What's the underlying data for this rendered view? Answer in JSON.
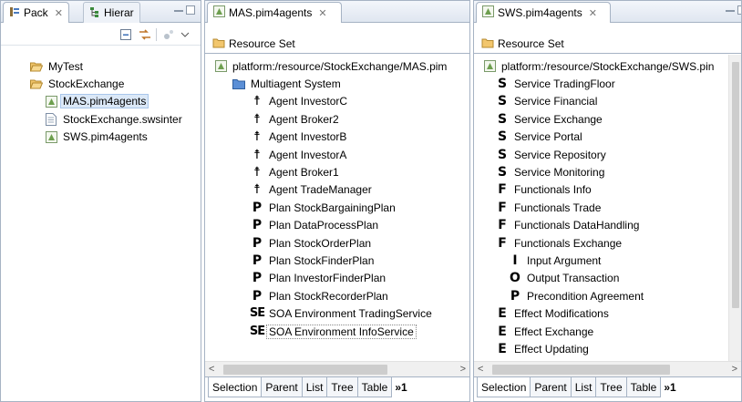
{
  "pack_pane": {
    "tabs": [
      {
        "label": "Pack",
        "active": true,
        "icon": "package-explorer-icon"
      },
      {
        "label": "Hierar",
        "active": false,
        "icon": "hierarchy-icon"
      }
    ],
    "tree": [
      {
        "label": "MyTest",
        "icon": "folder-open-icon",
        "depth": 1
      },
      {
        "label": "StockExchange",
        "icon": "folder-open-icon",
        "depth": 1
      },
      {
        "label": "MAS.pim4agents",
        "icon": "model-file-icon",
        "depth": 2,
        "selected": true
      },
      {
        "label": "StockExchange.swsinter",
        "icon": "text-file-icon",
        "depth": 2
      },
      {
        "label": "SWS.pim4agents",
        "icon": "model-file-icon",
        "depth": 2
      }
    ]
  },
  "mas_pane": {
    "tab_label": "MAS.pim4agents",
    "resource_set": "Resource Set",
    "tree": [
      {
        "label": "platform:/resource/StockExchange/MAS.pim",
        "icon": "model-file-icon",
        "glyph": "",
        "depth": 0
      },
      {
        "label": "Multiagent System",
        "icon": "folder-icon",
        "glyph": "",
        "depth": 1
      },
      {
        "label": "Agent InvestorC",
        "icon": "agent-icon",
        "glyph": "☨",
        "depth": 2
      },
      {
        "label": "Agent Broker2",
        "icon": "agent-icon",
        "glyph": "☨",
        "depth": 2
      },
      {
        "label": "Agent InvestorB",
        "icon": "agent-icon",
        "glyph": "☨",
        "depth": 2
      },
      {
        "label": "Agent InvestorA",
        "icon": "agent-icon",
        "glyph": "☨",
        "depth": 2
      },
      {
        "label": "Agent Broker1",
        "icon": "agent-icon",
        "glyph": "☨",
        "depth": 2
      },
      {
        "label": "Agent TradeManager",
        "icon": "agent-icon",
        "glyph": "☨",
        "depth": 2
      },
      {
        "label": "Plan StockBargainingPlan",
        "icon": "plan-icon",
        "glyph": "P",
        "depth": 2
      },
      {
        "label": "Plan DataProcessPlan",
        "icon": "plan-icon",
        "glyph": "P",
        "depth": 2
      },
      {
        "label": "Plan StockOrderPlan",
        "icon": "plan-icon",
        "glyph": "P",
        "depth": 2
      },
      {
        "label": "Plan StockFinderPlan",
        "icon": "plan-icon",
        "glyph": "P",
        "depth": 2
      },
      {
        "label": "Plan InvestorFinderPlan",
        "icon": "plan-icon",
        "glyph": "P",
        "depth": 2
      },
      {
        "label": "Plan StockRecorderPlan",
        "icon": "plan-icon",
        "glyph": "P",
        "depth": 2
      },
      {
        "label": "SOA Environment TradingService",
        "icon": "soa-environment-icon",
        "glyph": "SE",
        "depth": 2
      },
      {
        "label": "SOA Environment InfoService",
        "icon": "soa-environment-icon",
        "glyph": "SE",
        "depth": 2,
        "hilite": true
      }
    ],
    "bottom_tabs": [
      "Selection",
      "Parent",
      "List",
      "Tree",
      "Table"
    ],
    "more_tabs": "»1"
  },
  "sws_pane": {
    "tab_label": "SWS.pim4agents",
    "resource_set": "Resource Set",
    "tree": [
      {
        "label": "platform:/resource/StockExchange/SWS.pin",
        "icon": "model-file-icon",
        "glyph": "",
        "depth": 0
      },
      {
        "label": "Service TradingFloor",
        "icon": "service-icon",
        "glyph": "S",
        "depth": 1
      },
      {
        "label": "Service Financial",
        "icon": "service-icon",
        "glyph": "S",
        "depth": 1
      },
      {
        "label": "Service Exchange",
        "icon": "service-icon",
        "glyph": "S",
        "depth": 1
      },
      {
        "label": "Service Portal",
        "icon": "service-icon",
        "glyph": "S",
        "depth": 1
      },
      {
        "label": "Service Repository",
        "icon": "service-icon",
        "glyph": "S",
        "depth": 1
      },
      {
        "label": "Service Monitoring",
        "icon": "service-icon",
        "glyph": "S",
        "depth": 1
      },
      {
        "label": "Functionals Info",
        "icon": "functionals-icon",
        "glyph": "F",
        "depth": 1
      },
      {
        "label": "Functionals Trade",
        "icon": "functionals-icon",
        "glyph": "F",
        "depth": 1
      },
      {
        "label": "Functionals DataHandling",
        "icon": "functionals-icon",
        "glyph": "F",
        "depth": 1
      },
      {
        "label": "Functionals Exchange",
        "icon": "functionals-icon",
        "glyph": "F",
        "depth": 1
      },
      {
        "label": "Input Argument",
        "icon": "input-icon",
        "glyph": "I",
        "depth": 2
      },
      {
        "label": "Output Transaction",
        "icon": "output-icon",
        "glyph": "O",
        "depth": 2
      },
      {
        "label": "Precondition Agreement",
        "icon": "precondition-icon",
        "glyph": "P",
        "depth": 2
      },
      {
        "label": "Effect Modifications",
        "icon": "effect-icon",
        "glyph": "E",
        "depth": 1
      },
      {
        "label": "Effect Exchange",
        "icon": "effect-icon",
        "glyph": "E",
        "depth": 1
      },
      {
        "label": "Effect Updating",
        "icon": "effect-icon",
        "glyph": "E",
        "depth": 1
      }
    ],
    "bottom_tabs": [
      "Selection",
      "Parent",
      "List",
      "Tree",
      "Table"
    ],
    "more_tabs": "»1"
  },
  "colors": {
    "border": "#a6b3c4",
    "selection": "#dbe8f7",
    "folder": "#e8b84a",
    "model_icon": "#6d9f4e"
  }
}
